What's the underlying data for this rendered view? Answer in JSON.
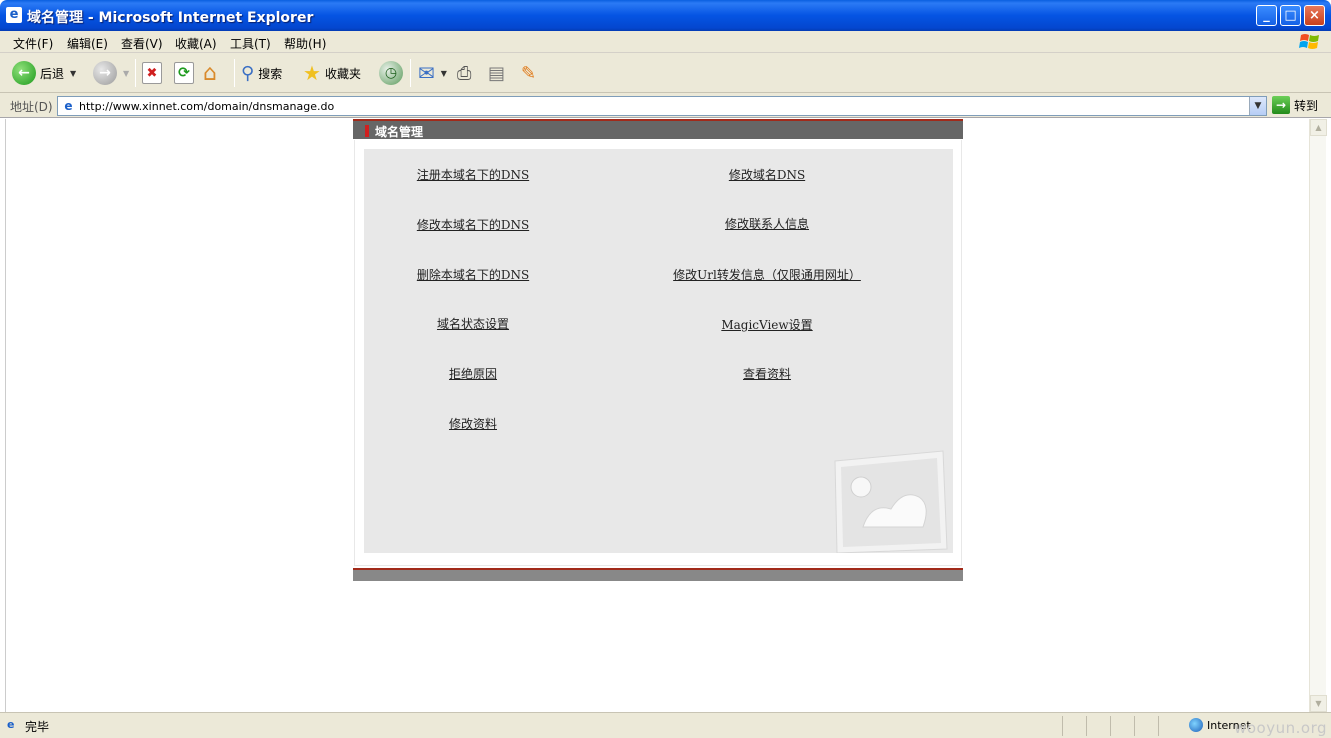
{
  "window": {
    "title": "域名管理 - Microsoft Internet Explorer",
    "minimize": "_",
    "maximize": "□",
    "close": "×"
  },
  "menu": {
    "items": [
      "文件(F)",
      "编辑(E)",
      "查看(V)",
      "收藏(A)",
      "工具(T)",
      "帮助(H)"
    ]
  },
  "toolbar": {
    "back_label": "后退",
    "search_label": "搜索",
    "favorites_label": "收藏夹"
  },
  "address": {
    "label": "地址(D)",
    "url": "http://www.xinnet.com/domain/dnsmanage.do",
    "go_label": "转到"
  },
  "panel": {
    "title": "域名管理",
    "links": [
      "注册本域名下的DNS",
      "修改域名DNS",
      "修改本域名下的DNS",
      "修改联系人信息",
      "删除本域名下的DNS",
      "修改Url转发信息（仅限通用网址）",
      "域名状态设置",
      "MagicView设置",
      "拒绝原因",
      "查看资料",
      "修改资料"
    ]
  },
  "status": {
    "text": "完毕",
    "zone": "Internet",
    "watermark": "wooyun.org"
  },
  "colors": {
    "title_blue": "#0554e3",
    "accent_red": "#a12a1a",
    "header_gray": "#666666"
  }
}
